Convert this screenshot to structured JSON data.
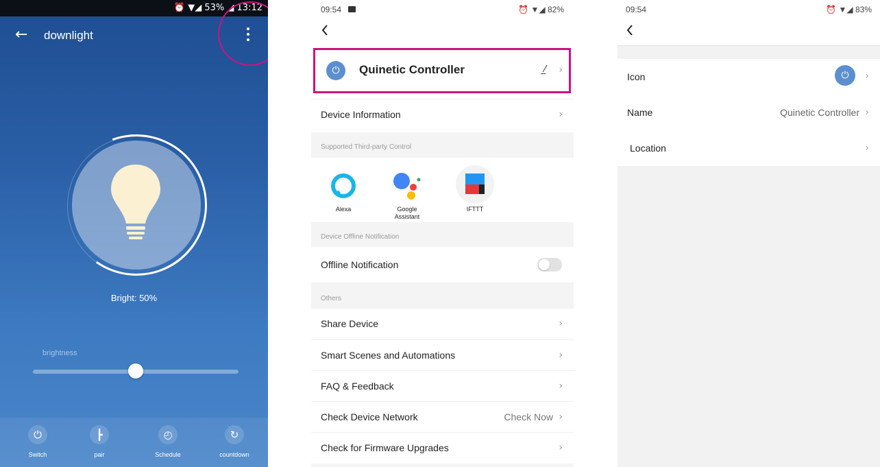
{
  "panel1": {
    "status": "⏰ ▼◢ 53% ◢ 13:12",
    "back_icon": "arrow-left-icon",
    "title": "downlight",
    "more_icon": "more-vertical-icon",
    "bright_text": "Bright: 50%",
    "brightness_label": "brightness",
    "brightness_value": 0.5,
    "bottom": [
      {
        "icon": "power-icon",
        "glyph": "⏻",
        "label": "Switch"
      },
      {
        "icon": "pair-icon",
        "glyph": "┣",
        "label": "pair"
      },
      {
        "icon": "clock-icon",
        "glyph": "◴",
        "label": "Schedule"
      },
      {
        "icon": "countdown-icon",
        "glyph": "↻",
        "label": "countdown"
      }
    ]
  },
  "panel2": {
    "time": "09:54",
    "status_right": "⏰ ▼◢ 82%",
    "device_name": "Quinetic Controller",
    "device_info": "Device Information",
    "section_third_party": "Supported Third-party Control",
    "third_party": [
      {
        "label": "Alexa"
      },
      {
        "label": "Google\nAssistant"
      },
      {
        "label": "IFTTT"
      }
    ],
    "section_offline": "Device Offline Notification",
    "offline_notification": "Offline Notification",
    "offline_enabled": false,
    "section_others": "Others",
    "share_device": "Share Device",
    "smart_scenes": "Smart Scenes and Automations",
    "faq": "FAQ & Feedback",
    "check_network": "Check Device Network",
    "check_now": "Check Now",
    "check_firmware": "Check for Firmware Upgrades"
  },
  "panel3": {
    "time": "09:54",
    "status_right": "⏰ ▼◢ 83%",
    "icon_label": "Icon",
    "name_label": "Name",
    "name_value": "Quinetic Controller",
    "location_label": "Location"
  },
  "colors": {
    "highlight": "#d01080",
    "accent": "#5b8fcf"
  }
}
